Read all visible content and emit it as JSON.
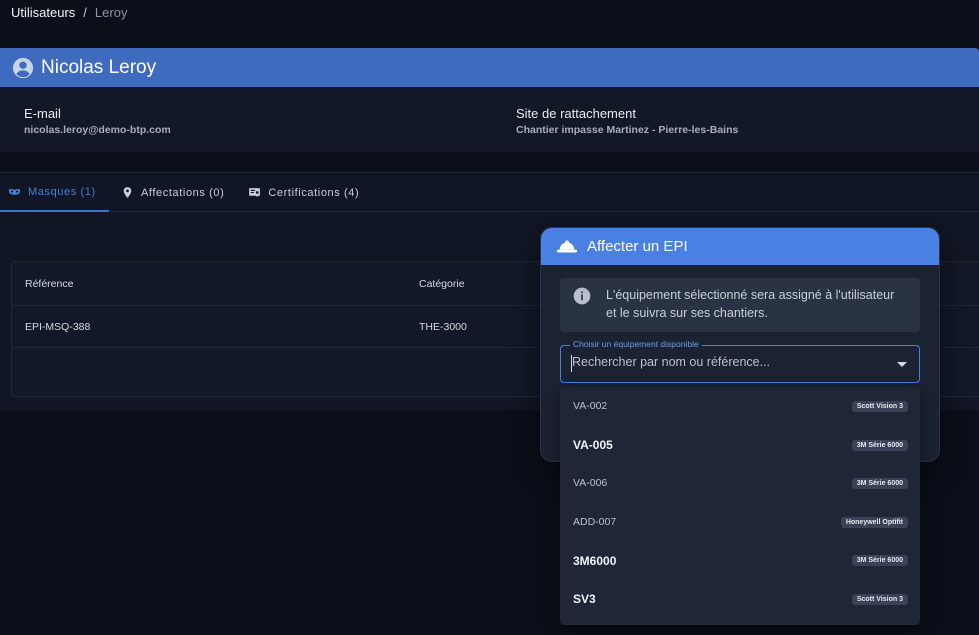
{
  "breadcrumb": {
    "root": "Utilisateurs",
    "separator": "/",
    "current": "Leroy"
  },
  "user": {
    "name": "Nicolas Leroy",
    "email_label": "E-mail",
    "email": "nicolas.leroy@demo-btp.com",
    "site_label": "Site de rattachement",
    "site": "Chantier impasse Martinez - Pierre-les-Bains"
  },
  "tabs": [
    {
      "label": "Masques (1)",
      "icon": "mask-icon",
      "active": true
    },
    {
      "label": "Affectations (0)",
      "icon": "location-pin-icon",
      "active": false
    },
    {
      "label": "Certifications (4)",
      "icon": "certificate-icon",
      "active": false
    }
  ],
  "table": {
    "headers": {
      "reference": "Référence",
      "category": "Catégorie"
    },
    "rows": [
      {
        "reference": "EPI-MSQ-388",
        "category": "THE-3000"
      }
    ]
  },
  "dialog": {
    "title": "Affecter un EPI",
    "icon": "hard-hat-icon",
    "info": "L'équipement sélectionné sera assigné à l'utilisateur et le suivra sur ses chantiers.",
    "field_label": "Choisir un équipement disponible",
    "placeholder": "Rechercher par nom ou référence..."
  },
  "options": [
    {
      "code": "VA-002",
      "model": "Scott Vision 3"
    },
    {
      "code": "VA-005",
      "model": "3M Série 6000"
    },
    {
      "code": "VA-006",
      "model": "3M Série 6000"
    },
    {
      "code": "ADD-007",
      "model": "Honeywell Optifit"
    },
    {
      "code": "3M6000",
      "model": "3M Série 6000"
    },
    {
      "code": "SV3",
      "model": "Scott Vision 3"
    }
  ],
  "colors": {
    "accent": "#4a80e4",
    "header": "#3f6bbe",
    "background": "#0b0f19"
  }
}
